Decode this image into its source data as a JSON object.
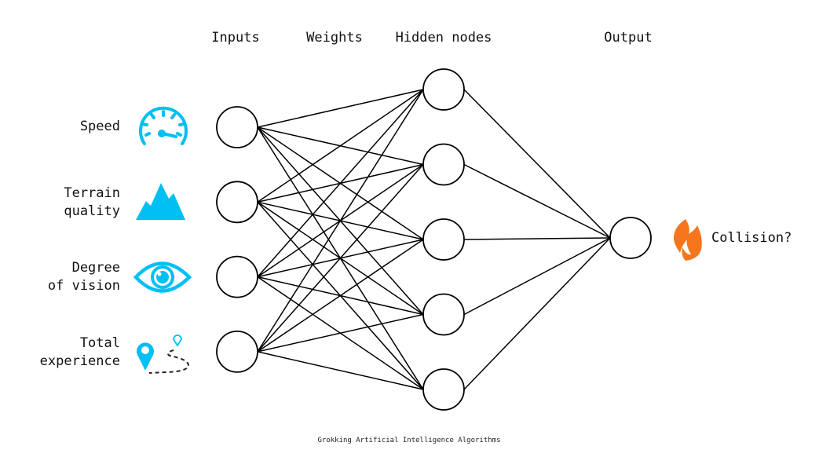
{
  "headers": {
    "inputs": "Inputs",
    "weights": "Weights",
    "hidden": "Hidden nodes",
    "output": "Output"
  },
  "inputs": [
    {
      "label_lines": [
        "Speed"
      ],
      "icon": "speedometer-icon"
    },
    {
      "label_lines": [
        "Terrain",
        "quality"
      ],
      "icon": "mountain-icon"
    },
    {
      "label_lines": [
        "Degree",
        "of vision"
      ],
      "icon": "eye-icon"
    },
    {
      "label_lines": [
        "Total",
        "experience"
      ],
      "icon": "map-route-icon"
    }
  ],
  "hidden_count": 5,
  "output": {
    "label": "Collision?",
    "icon": "fire-icon"
  },
  "caption": "Grokking Artificial Intelligence Algorithms",
  "colors": {
    "icon_blue": "#00BFF3",
    "fire_orange": "#F7761B",
    "line": "#000000"
  }
}
